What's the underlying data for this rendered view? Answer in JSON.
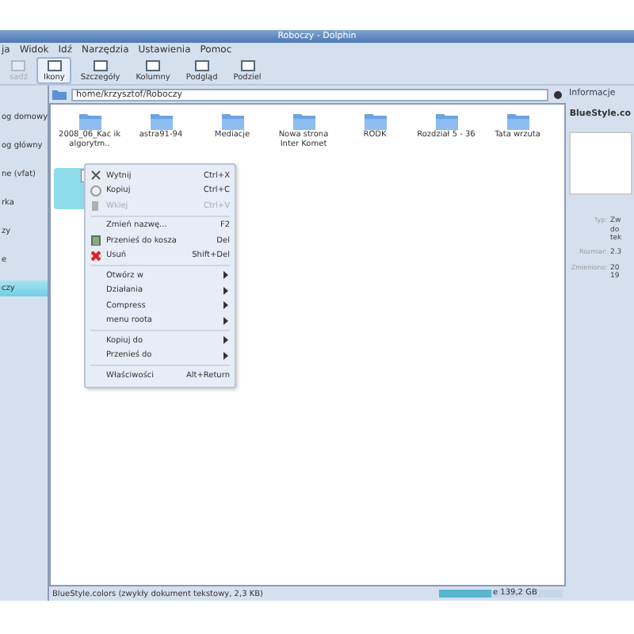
{
  "window": {
    "title": "Roboczy - Dolphin"
  },
  "menu_bar": [
    "ja",
    "Widok",
    "Idź",
    "Narzędzia",
    "Ustawienia",
    "Pomoc"
  ],
  "toolbar": [
    {
      "label": "sadź",
      "disabled": true,
      "selected": false
    },
    {
      "label": "Ikony",
      "disabled": false,
      "selected": true
    },
    {
      "label": "Szczegóły",
      "disabled": false,
      "selected": false
    },
    {
      "label": "Kolumny",
      "disabled": false,
      "selected": false
    },
    {
      "label": "Podgląd",
      "disabled": false,
      "selected": false
    },
    {
      "label": "Podziel",
      "disabled": false,
      "selected": false
    }
  ],
  "places": [
    {
      "label": "og domowy",
      "selected": false
    },
    {
      "label": "og główny",
      "selected": false
    },
    {
      "label": "ne (vfat)",
      "selected": false
    },
    {
      "label": "rka",
      "selected": false
    },
    {
      "label": "zy",
      "selected": false
    },
    {
      "label": "e",
      "selected": false
    },
    {
      "label": "czy",
      "selected": true
    }
  ],
  "location": "home/krzysztof/Roboczy",
  "files": [
    {
      "name": "2008_06_Kac ik algorytm..",
      "kind": "folder",
      "selected": false
    },
    {
      "name": "astra91-94",
      "kind": "folder",
      "selected": false
    },
    {
      "name": "Mediacje",
      "kind": "folder",
      "selected": false
    },
    {
      "name": "Nowa strona Inter Komet",
      "kind": "folder",
      "selected": false
    },
    {
      "name": "RODK",
      "kind": "folder",
      "selected": false
    },
    {
      "name": "Rozdział 5 - 36",
      "kind": "folder",
      "selected": false
    },
    {
      "name": "Tata wrzuta",
      "kind": "folder",
      "selected": false
    },
    {
      "kind": "document",
      "selected": true
    }
  ],
  "context_menu": [
    [
      {
        "label": "Wytnij",
        "shortcut": "Ctrl+X",
        "disabled": false,
        "submenu": false
      },
      {
        "label": "Kopiuj",
        "shortcut": "Ctrl+C",
        "disabled": false,
        "submenu": false
      },
      {
        "label": "Wklej",
        "shortcut": "Ctrl+V",
        "disabled": true,
        "submenu": false
      }
    ],
    [
      {
        "label": "Zmień nazwę...",
        "shortcut": "F2",
        "disabled": false,
        "submenu": false
      },
      {
        "label": "Przenieś do kosza",
        "shortcut": "Del",
        "disabled": false,
        "submenu": false
      },
      {
        "label": "Usuń",
        "shortcut": "Shift+Del",
        "disabled": false,
        "submenu": false
      }
    ],
    [
      {
        "label": "Otwórz w",
        "disabled": false,
        "submenu": true
      },
      {
        "label": "Działania",
        "disabled": false,
        "submenu": true
      },
      {
        "label": "Compress",
        "disabled": false,
        "submenu": true
      },
      {
        "label": "menu roota",
        "disabled": false,
        "submenu": true
      }
    ],
    [
      {
        "label": "Kopiuj do",
        "disabled": false,
        "submenu": true
      },
      {
        "label": "Przenieś do",
        "disabled": false,
        "submenu": true
      }
    ],
    [
      {
        "label": "Właściwości",
        "shortcut": "Alt+Return",
        "disabled": false,
        "submenu": false
      }
    ]
  ],
  "info_panel": {
    "title": "Informacje",
    "file_name": "BlueStyle.co",
    "fields": [
      {
        "label": "Typ:",
        "value": "Zw do tek"
      },
      {
        "label": "Rozmiar:",
        "value": "2.3"
      },
      {
        "label": "Zmieniono:",
        "value": "20 19"
      }
    ]
  },
  "status_bar": {
    "text": "BlueStyle.colors (zwykły dokument tekstowy, 2,3 KB)",
    "disk": {
      "text": "e 139,2 GB",
      "level": 0.42
    }
  }
}
